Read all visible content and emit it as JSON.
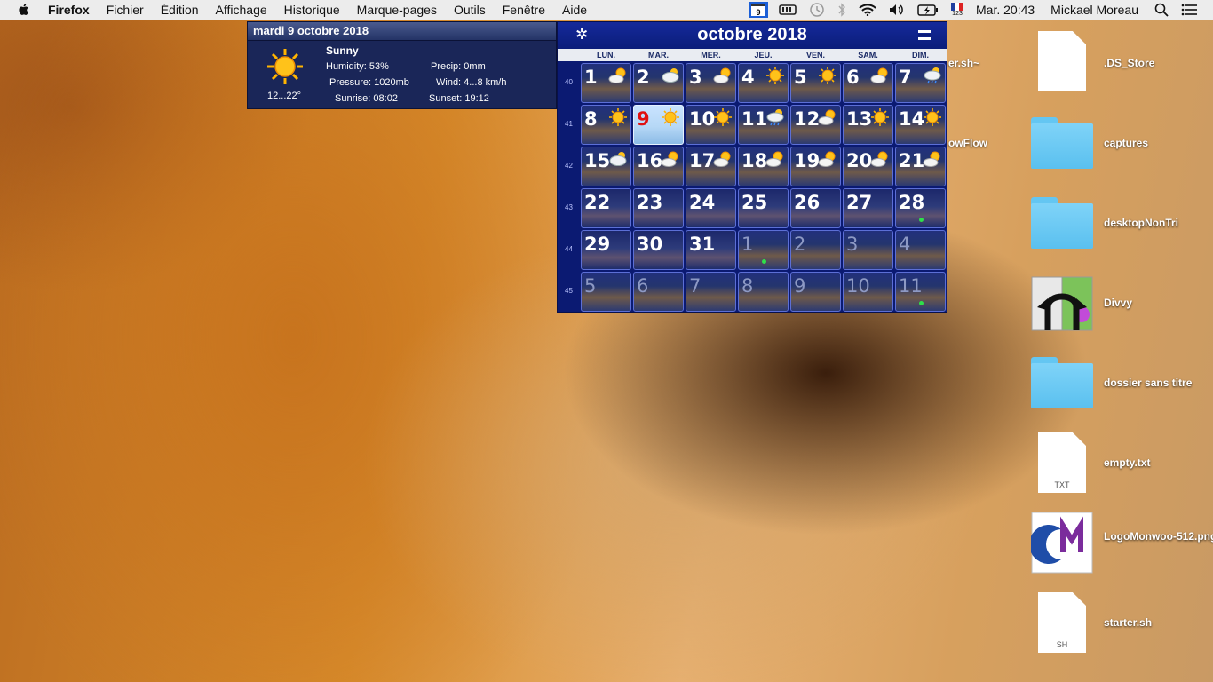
{
  "menubar": {
    "items": [
      "Firefox",
      "Fichier",
      "Édition",
      "Affichage",
      "Historique",
      "Marque-pages",
      "Outils",
      "Fenêtre",
      "Aide"
    ],
    "status": {
      "calendar_day": "9",
      "flag_number": "123",
      "clock": "Mar. 20:43",
      "user": "Mickael Moreau"
    }
  },
  "weather": {
    "date_header": "mardi 9 octobre 2018",
    "condition": "Sunny",
    "humidity": "Humidity: 53%",
    "precip": "Precip: 0mm",
    "pressure": "Pressure: 1020mb",
    "wind": "Wind: 4...8 km/h",
    "sunrise": "Sunrise: 08:02",
    "sunset": "Sunset: 19:12",
    "temperature": "12...22°"
  },
  "calendar": {
    "title": "octobre 2018",
    "weekdays": [
      "LUN.",
      "MAR.",
      "MER.",
      "JEU.",
      "VEN.",
      "SAM.",
      "DIM."
    ],
    "weeks": [
      "40",
      "41",
      "42",
      "43",
      "44",
      "45"
    ],
    "days": [
      {
        "n": "1",
        "wx": "partly-cloudy"
      },
      {
        "n": "2",
        "wx": "cloudy"
      },
      {
        "n": "3",
        "wx": "partly-cloudy"
      },
      {
        "n": "4",
        "wx": "sunny"
      },
      {
        "n": "5",
        "wx": "sunny"
      },
      {
        "n": "6",
        "wx": "partly-cloudy"
      },
      {
        "n": "7",
        "wx": "rain"
      },
      {
        "n": "8",
        "wx": "sunny"
      },
      {
        "n": "9",
        "wx": "sunny",
        "today": true
      },
      {
        "n": "10",
        "wx": "sunny"
      },
      {
        "n": "11",
        "wx": "rain"
      },
      {
        "n": "12",
        "wx": "partly-cloudy"
      },
      {
        "n": "13",
        "wx": "sunny"
      },
      {
        "n": "14",
        "wx": "sunny"
      },
      {
        "n": "15",
        "wx": "cloudy"
      },
      {
        "n": "16",
        "wx": "partly-cloudy"
      },
      {
        "n": "17",
        "wx": "partly-cloudy"
      },
      {
        "n": "18",
        "wx": "partly-cloudy"
      },
      {
        "n": "19",
        "wx": "partly-cloudy"
      },
      {
        "n": "20",
        "wx": "partly-cloudy"
      },
      {
        "n": "21",
        "wx": "partly-cloudy"
      },
      {
        "n": "22"
      },
      {
        "n": "23"
      },
      {
        "n": "24"
      },
      {
        "n": "25"
      },
      {
        "n": "26"
      },
      {
        "n": "27"
      },
      {
        "n": "28",
        "event": true
      },
      {
        "n": "29"
      },
      {
        "n": "30"
      },
      {
        "n": "31"
      },
      {
        "n": "1",
        "dim": true,
        "event": true
      },
      {
        "n": "2",
        "dim": true
      },
      {
        "n": "3",
        "dim": true
      },
      {
        "n": "4",
        "dim": true
      },
      {
        "n": "5",
        "dim": true
      },
      {
        "n": "6",
        "dim": true
      },
      {
        "n": "7",
        "dim": true
      },
      {
        "n": "8",
        "dim": true
      },
      {
        "n": "9",
        "dim": true
      },
      {
        "n": "10",
        "dim": true
      },
      {
        "n": "11",
        "dim": true,
        "event": true
      }
    ]
  },
  "desktop": {
    "partial_labels": [
      "er.sh~",
      "owFlow"
    ],
    "icons": [
      {
        "label": ".DS_Store",
        "kind": "document"
      },
      {
        "label": "captures",
        "kind": "folder"
      },
      {
        "label": "desktopNonTri",
        "kind": "folder"
      },
      {
        "label": "Divvy",
        "kind": "app"
      },
      {
        "label": "dossier sans titre",
        "kind": "folder"
      },
      {
        "label": "empty.txt",
        "kind": "document",
        "ext": "TXT"
      },
      {
        "label": "LogoMonwoo-512.png",
        "label_line2": "png",
        "kind": "image"
      },
      {
        "label": "starter.sh",
        "kind": "document",
        "ext": "SH"
      }
    ]
  },
  "colors": {
    "calendar_bg": "#0b1a72",
    "weather_bg": "#1a2658",
    "today_red": "#e01010",
    "event_dot": "#2ee04a",
    "folder_blue": "#5ac0ef"
  }
}
